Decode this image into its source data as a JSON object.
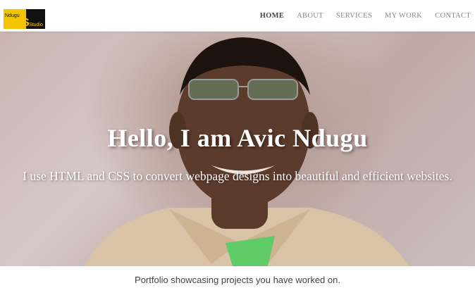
{
  "brand": {
    "logo_text_1": "Ndugu",
    "logo_text_2": "Studio"
  },
  "nav": {
    "items": [
      {
        "label": "HOME",
        "active": true
      },
      {
        "label": "ABOUT"
      },
      {
        "label": "SERVICES"
      },
      {
        "label": "MY WORK"
      },
      {
        "label": "CONTACT"
      }
    ]
  },
  "hero": {
    "title": "Hello, I am Avic Ndugu",
    "subtitle": "I use HTML and CSS to convert webpage designs into beautiful and efficient websites."
  },
  "portfolio": {
    "intro": "Portfolio showcasing projects you have worked on."
  },
  "colors": {
    "accent": "#2fb89a",
    "logo_yellow": "#f5c400"
  }
}
